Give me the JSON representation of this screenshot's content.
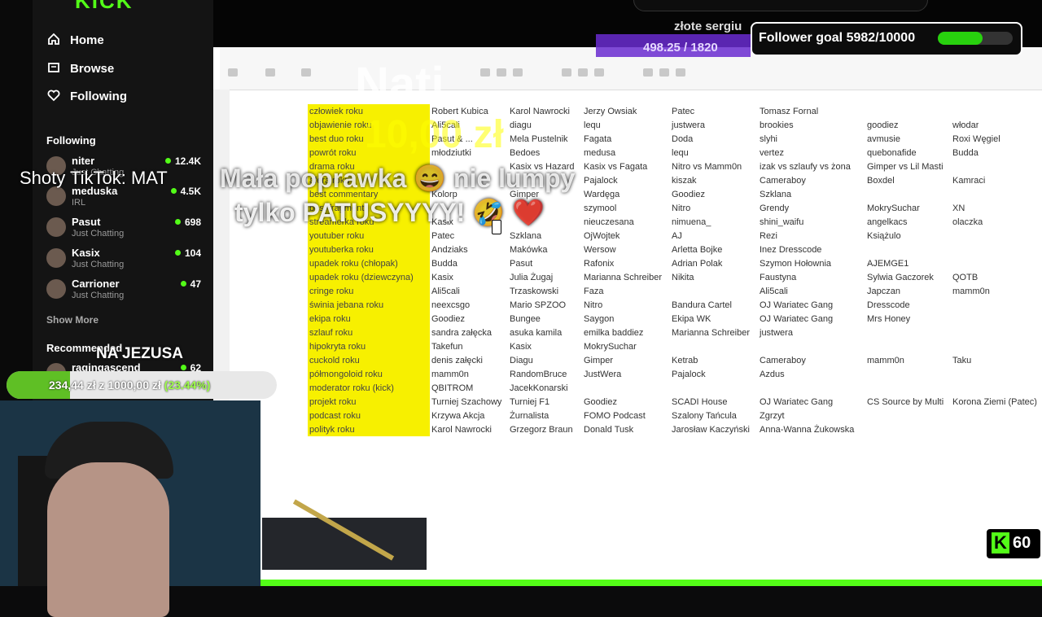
{
  "colors": {
    "accent": "#53fc18",
    "goal_fill": "#28d10e",
    "highlight": "#f7f000",
    "heart": "#e01a2f"
  },
  "nav": {
    "logo": "KICK",
    "items": [
      {
        "label": "Home",
        "icon": "home-icon"
      },
      {
        "label": "Browse",
        "icon": "browse-icon"
      },
      {
        "label": "Following",
        "icon": "heart-icon"
      }
    ]
  },
  "following": {
    "title": "Following",
    "show_more": "Show More",
    "channels": [
      {
        "name": "niter",
        "category": "Just Chatting",
        "viewers": "12.4K"
      },
      {
        "name": "meduska",
        "category": "IRL",
        "viewers": "4.5K"
      },
      {
        "name": "Pasut",
        "category": "Just Chatting",
        "viewers": "698"
      },
      {
        "name": "Kasix",
        "category": "Just Chatting",
        "viewers": "104"
      },
      {
        "name": "Carrioner",
        "category": "Just Chatting",
        "viewers": "47"
      }
    ]
  },
  "recommended": {
    "title": "Recommended",
    "channels": [
      {
        "name": "ragingascend",
        "viewers": "62"
      }
    ]
  },
  "overlay": {
    "follower_goal": "Follower goal 5982/10000",
    "follower_goal_progress": 0.5982,
    "donor_name": "złote sergiu",
    "purple_text": "498.25 / 1820",
    "tip_name": "Nati",
    "tip_amount": "10,00 zł",
    "tip_message_1": "Mała poprawka 😄 nie lumpy",
    "tip_message_2": "tylko PATUSYYYY! 🤣 ❤️",
    "shoty": "Shoty TikTok: MAT",
    "jezus_title": "NA JEZUSA",
    "jezus_progress_text": "234,44 zł z 1000,00 zł",
    "jezus_progress_pct": "(23.44%)",
    "jezus_progress": 0.2344,
    "kick_viewers": "60"
  },
  "spreadsheet": {
    "categories": [
      "człowiek roku",
      "objawienie roku",
      "best duo roku",
      "powrót roku",
      "drama roku",
      "afera roku",
      "best commentary",
      "best fragment",
      "streamerka roku",
      "youtuber roku",
      "youtuberka roku",
      "upadek roku (chłopak)",
      "upadek roku (dziewczyna)",
      "cringe roku",
      "świnia jebana roku",
      "ekipa roku",
      "szlauf roku",
      "hipokryta roku",
      "cuckold roku",
      "półmongoloid roku",
      "moderator roku (kick)",
      "projekt roku",
      "podcast roku",
      "polityk roku"
    ],
    "col1": [
      "Robert Kubica",
      "Ali5cali",
      "Pasut & ...",
      "młodziutki",
      "",
      "",
      "Kolorp",
      "",
      "Kasix",
      "Patec",
      "Andziaks",
      "Budda",
      "Kasix",
      "Ali5cali",
      "neexcsgo",
      "Goodiez",
      "sandra załęcka",
      "Takefun",
      "denis załęcki",
      "mamm0n",
      "QBITROM",
      "Turniej Szachowy",
      "Krzywa Akcja",
      "Karol Nawrocki"
    ],
    "col2": [
      "Karol Nawrocki",
      "diagu",
      "Mela Pustelnik",
      "Bedoes",
      "Kasix vs Hazard",
      "",
      "Gimper",
      "",
      "",
      "Szklana",
      "Makówka",
      "Pasut",
      "Julia Żugaj",
      "Trzaskowski",
      "Mario SPZOO",
      "Bungee",
      "asuka kamila",
      "Kasix",
      "Diagu",
      "RandomBruce",
      "JacekKonarski",
      "Turniej F1",
      "Żurnalista",
      "Grzegorz Braun"
    ],
    "col3": [
      "Jerzy Owsiak",
      "lequ",
      "Fagata",
      "medusa",
      "Kasix vs Fagata",
      "Pajalock",
      "Wardęga",
      "szymool",
      "nieuczesana",
      "OjWojtek",
      "Wersow",
      "Rafonix",
      "Marianna Schreiber",
      "Faza",
      "Nitro",
      "Saygon",
      "emilka baddiez",
      "MokrySuchar",
      "Gimper",
      "JustWera",
      "",
      "Goodiez",
      "FOMO Podcast",
      "Donald Tusk"
    ],
    "col4": [
      "Patec",
      "justwera",
      "Doda",
      "lequ",
      "Nitro vs Mamm0n",
      "kiszak",
      "Goodiez",
      "Nitro",
      "nimuena_",
      "AJ",
      "Arletta Bojke",
      "Adrian Polak",
      "Nikita",
      "",
      "Bandura Cartel",
      "Ekipa WK",
      "Marianna Schreiber",
      "",
      "Ketrab",
      "Pajalock",
      "",
      "SCADI House",
      "Szalony Tańcula",
      "Jarosław Kaczyński"
    ],
    "col5": [
      "Tomasz Fornal",
      "brookies",
      "slyhi",
      "vertez",
      "izak vs szlaufy vs żona",
      "Cameraboy",
      "Szklana",
      "Grendy",
      "shini_waifu",
      "Rezi",
      "Inez Dresscode",
      "Szymon Hołownia",
      "Faustyna",
      "Ali5cali",
      "OJ Wariatec Gang",
      "OJ Wariatec Gang",
      "justwera",
      "",
      "Cameraboy",
      "Azdus",
      "",
      "OJ Wariatec Gang",
      "Zgrzyt",
      "Anna-Wanna Żukowska"
    ],
    "col6": [
      "",
      "goodiez",
      "avmusie",
      "quebonafide",
      "Gimper vs Lil Masti",
      "Boxdel",
      "",
      "MokrySuchar",
      "angelkacs",
      "Książulo",
      "",
      "AJEMGE1",
      "Sylwia Gaczorek",
      "Japczan",
      "Dresscode",
      "Mrs Honey",
      "",
      "",
      "mamm0n",
      "",
      "",
      "CS Source by Multi",
      "",
      ""
    ],
    "col7": [
      "",
      "włodar",
      "Roxi Węgiel",
      "Budda",
      "",
      "Kamraci",
      "",
      "XN",
      "olaczka",
      "",
      "",
      "",
      "QOTB",
      "mamm0n",
      "",
      "",
      "",
      "",
      "Taku",
      "",
      "",
      "Korona Ziemi (Patec)",
      "",
      ""
    ]
  }
}
